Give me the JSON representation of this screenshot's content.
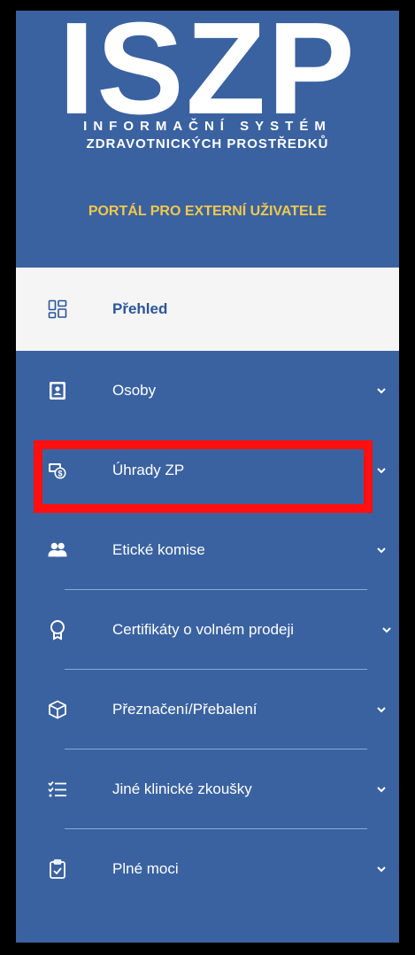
{
  "logo": {
    "big": "ISZP",
    "line1": "INFORMAČNÍ SYSTÉM",
    "line2": "ZDRAVOTNICKÝCH PROSTŘEDKŮ"
  },
  "portal_label": "PORTÁL PRO EXTERNÍ UŽIVATELE",
  "nav": {
    "items": [
      {
        "label": "Přehled",
        "icon": "dashboard-icon",
        "active": true
      },
      {
        "label": "Osoby",
        "icon": "person-document-icon"
      },
      {
        "label": "Úhrady ZP",
        "icon": "payment-icon"
      },
      {
        "label": "Etické komise",
        "icon": "group-icon"
      },
      {
        "label": "Certifikáty o volném prodeji",
        "icon": "award-icon"
      },
      {
        "label": "Přeznačení/Přebalení",
        "icon": "box-icon"
      },
      {
        "label": "Jiné klinické zkoušky",
        "icon": "checklist-icon"
      },
      {
        "label": "Plné moci",
        "icon": "clipboard-check-icon"
      }
    ]
  },
  "colors": {
    "sidebar_bg": "#3A62A0",
    "active_bg": "#F5F5F5",
    "active_text": "#2A5599",
    "portal_label": "#F2C84B",
    "highlight": "#FF1010"
  }
}
